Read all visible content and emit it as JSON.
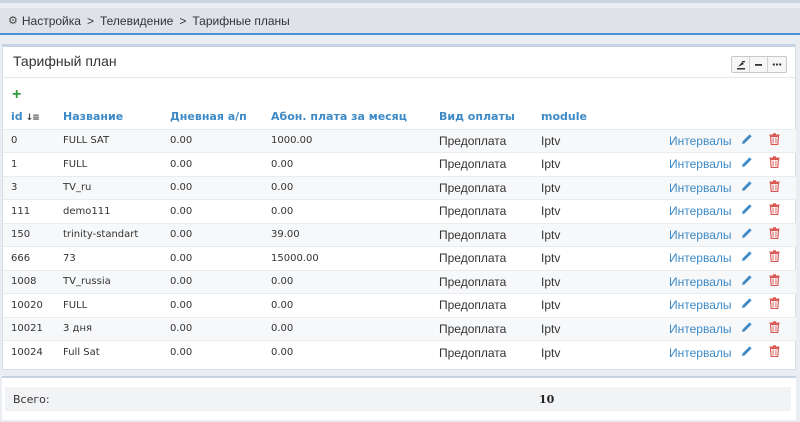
{
  "breadcrumb": {
    "items": [
      "Настройка",
      "Телевидение",
      "Тарифные планы"
    ],
    "separator": ">"
  },
  "panel": {
    "title": "Тарифный план"
  },
  "columns": {
    "id": "id",
    "name": "Название",
    "daily": "Дневная а/п",
    "monthly": "Абон. плата за месяц",
    "payment": "Вид оплаты",
    "module": "module"
  },
  "rows": [
    {
      "id": "0",
      "name": "FULL SAT",
      "daily": "0.00",
      "monthly": "1000.00",
      "payment": "Предоплата",
      "module": "Iptv",
      "intervals": "Интервалы"
    },
    {
      "id": "1",
      "name": "FULL",
      "daily": "0.00",
      "monthly": "0.00",
      "payment": "Предоплата",
      "module": "Iptv",
      "intervals": "Интервалы"
    },
    {
      "id": "3",
      "name": "TV_ru",
      "daily": "0.00",
      "monthly": "0.00",
      "payment": "Предоплата",
      "module": "Iptv",
      "intervals": "Интервалы"
    },
    {
      "id": "111",
      "name": "demo111",
      "daily": "0.00",
      "monthly": "0.00",
      "payment": "Предоплата",
      "module": "Iptv",
      "intervals": "Интервалы"
    },
    {
      "id": "150",
      "name": "trinity-standart",
      "daily": "0.00",
      "monthly": "39.00",
      "payment": "Предоплата",
      "module": "Iptv",
      "intervals": "Интервалы"
    },
    {
      "id": "666",
      "name": "73",
      "daily": "0.00",
      "monthly": "15000.00",
      "payment": "Предоплата",
      "module": "Iptv",
      "intervals": "Интервалы"
    },
    {
      "id": "1008",
      "name": "TV_russia",
      "daily": "0.00",
      "monthly": "0.00",
      "payment": "Предоплата",
      "module": "Iptv",
      "intervals": "Интервалы"
    },
    {
      "id": "10020",
      "name": "FULL",
      "daily": "0.00",
      "monthly": "0.00",
      "payment": "Предоплата",
      "module": "Iptv",
      "intervals": "Интервалы"
    },
    {
      "id": "10021",
      "name": "3 дня",
      "daily": "0.00",
      "monthly": "0.00",
      "payment": "Предоплата",
      "module": "Iptv",
      "intervals": "Интервалы"
    },
    {
      "id": "10024",
      "name": "Full Sat",
      "daily": "0.00",
      "monthly": "0.00",
      "payment": "Предоплата",
      "module": "Iptv",
      "intervals": "Интервалы"
    }
  ],
  "footer": {
    "total_label": "Всего:",
    "total_value": "10"
  },
  "colors": {
    "accent": "#3d8ac6",
    "add": "#2e9b3e",
    "delete": "#d9534f",
    "header_border": "#4a90d4"
  },
  "icons": {
    "breadcrumb": "gear-icon",
    "add": "plus-icon",
    "sort": "sort-icon",
    "edit": "pencil-icon",
    "delete": "trash-icon",
    "tools": [
      "export-icon",
      "minimize-icon",
      "more-icon"
    ]
  }
}
